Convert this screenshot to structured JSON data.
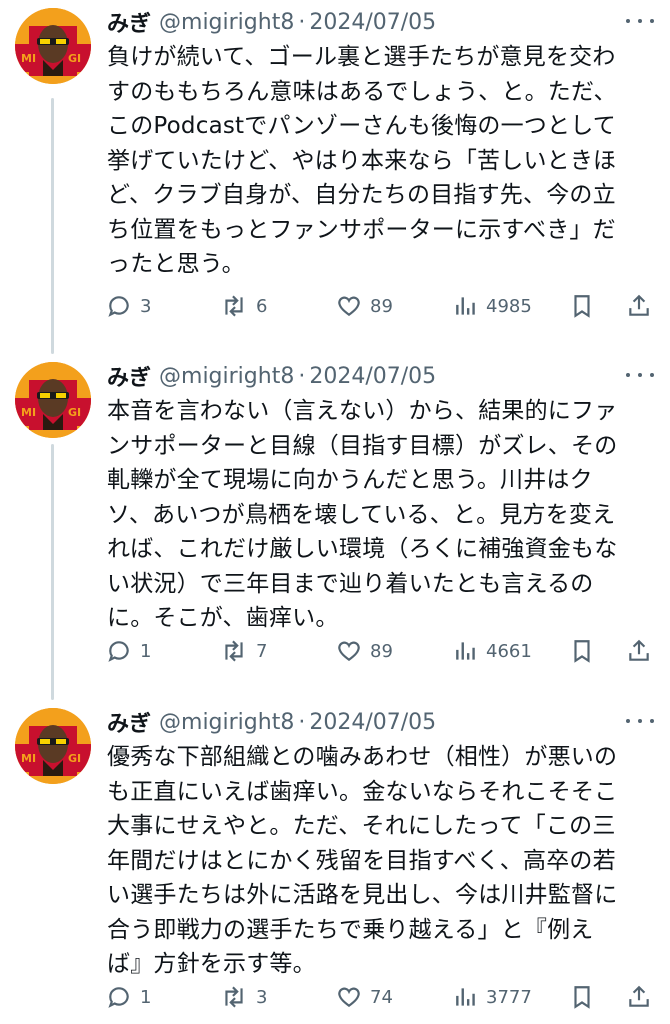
{
  "tweets": [
    {
      "display_name": "みぎ",
      "handle": "@migiright8",
      "separator": "·",
      "date": "2024/07/05",
      "lines": [
        "負けが続いて、ゴール裏と選手たちが意見を交わ",
        "すのももちろん意味はあるでしょう、と。ただ、",
        "このPodcastでパンゾーさんも後悔の一つとして",
        "挙げていたけど、やはり本来なら「苦しいときほ",
        "ど、クラブ自身が、自分たちの目指す先、今の立",
        "ち位置をもっとファンサポーターに示すべき」だ",
        "ったと思う。"
      ],
      "replies": "3",
      "reposts": "6",
      "likes": "89",
      "views": "4985"
    },
    {
      "display_name": "みぎ",
      "handle": "@migiright8",
      "separator": "·",
      "date": "2024/07/05",
      "lines": [
        "本音を言わない（言えない）から、結果的にファ",
        "ンサポーターと目線（目指す目標）がズレ、その",
        "軋轢が全て現場に向かうんだと思う。川井はク",
        "ソ、あいつが鳥栖を壊している、と。見方を変え",
        "れば、これだけ厳しい環境（ろくに補強資金もな",
        "い状況）で三年目まで辿り着いたとも言えるの",
        "に。そこが、歯痒い。"
      ],
      "replies": "1",
      "reposts": "7",
      "likes": "89",
      "views": "4661"
    },
    {
      "display_name": "みぎ",
      "handle": "@migiright8",
      "separator": "·",
      "date": "2024/07/05",
      "lines": [
        "優秀な下部組織との噛みあわせ（相性）が悪いの",
        "も正直にいえば歯痒い。金ないならそれこそそこ",
        "大事にせえやと。ただ、それにしたって「この三",
        "年間だけはとにかく残留を目指すべく、高卒の若",
        "い選手たちは外に活路を見出し、今は川井監督に",
        "合う即戦力の選手たちで乗り越える」と『例え",
        "ば』方針を示す等。"
      ],
      "replies": "1",
      "reposts": "3",
      "likes": "74",
      "views": "3777"
    }
  ],
  "avatar_text": "MIGI",
  "icons": {
    "reply": "speech-bubble-icon",
    "repost": "repost-arrows-icon",
    "like": "heart-icon",
    "views": "bar-chart-icon",
    "bookmark": "bookmark-icon",
    "share": "share-upload-icon",
    "more": "more-dots-icon"
  },
  "colors": {
    "text": "#0f1419",
    "secondary": "#536471",
    "thread_line": "#cfd9de",
    "avatar_bg": "#f3a01c",
    "avatar_red": "#c8102e"
  }
}
